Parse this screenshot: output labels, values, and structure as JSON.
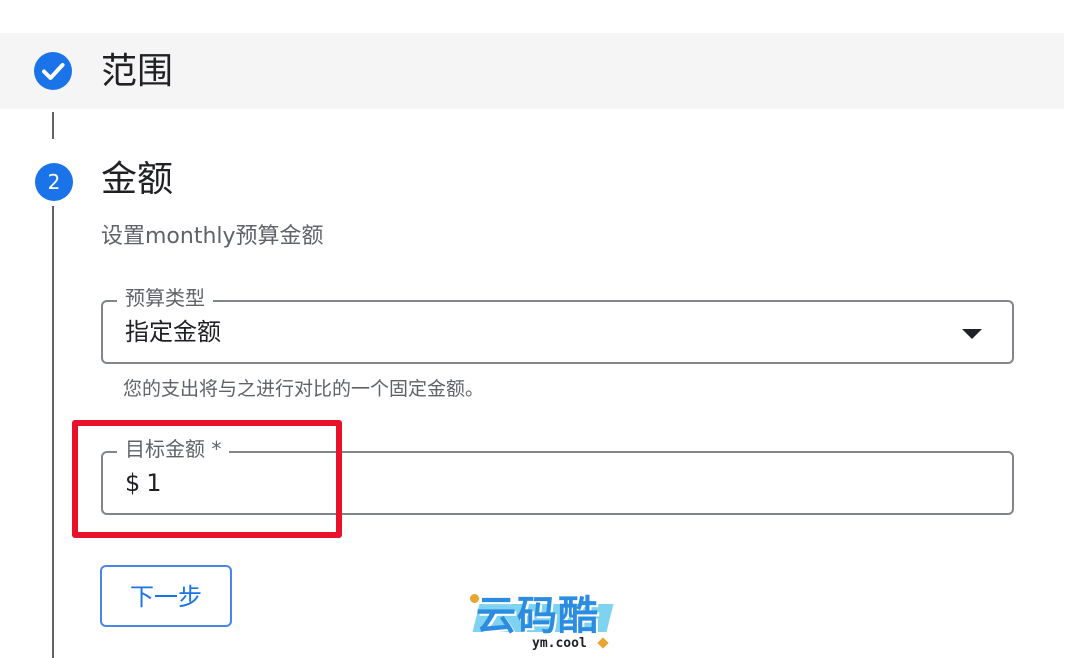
{
  "steps": {
    "step1": {
      "title": "范围",
      "status": "completed"
    },
    "step2": {
      "number": "2",
      "title": "金额",
      "subtitle": "设置monthly预算金额"
    }
  },
  "budget_type": {
    "label": "预算类型",
    "value": "指定金额",
    "helper": "您的支出将与之进行对比的一个固定金额。"
  },
  "target_amount": {
    "label": "目标金额 *",
    "currency": "$",
    "value": "1"
  },
  "actions": {
    "next_label": "下一步"
  },
  "watermark": {
    "brand": "云码酷",
    "domain": "ym.cool"
  },
  "colors": {
    "accent": "#1a73e8",
    "highlight": "#e8132b"
  }
}
